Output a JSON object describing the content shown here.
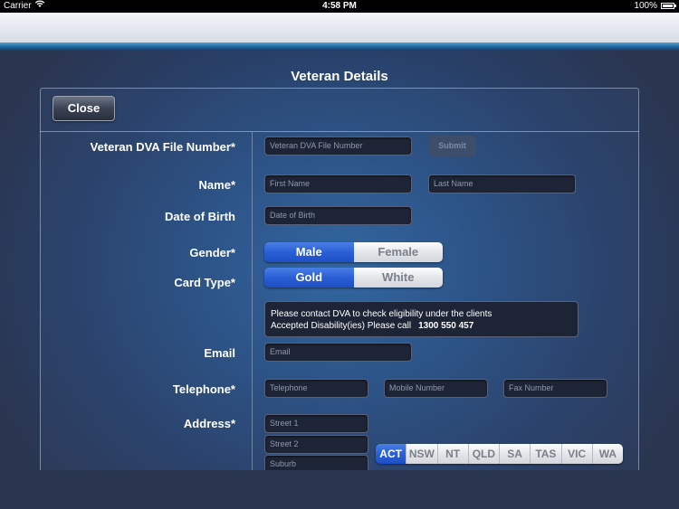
{
  "status_bar": {
    "carrier": "Carrier",
    "wifi_icon": "wifi-icon",
    "time": "4:58 PM",
    "battery_pct": "100%",
    "battery_icon": "battery-icon"
  },
  "page": {
    "title": "Veteran Details"
  },
  "toolbar": {
    "close_label": "Close",
    "submit_label": "Submit"
  },
  "labels": {
    "dva": "Veteran DVA File Number*",
    "name": "Name*",
    "dob": "Date of Birth",
    "gender": "Gender*",
    "card_type": "Card Type*",
    "email": "Email",
    "telephone": "Telephone*",
    "address": "Address*"
  },
  "placeholders": {
    "dva": "Veteran DVA File Number",
    "first_name": "First Name",
    "last_name": "Last Name",
    "dob": "Date of Birth",
    "email": "Email",
    "telephone": "Telephone",
    "mobile": "Mobile Number",
    "fax": "Fax Number",
    "street1": "Street 1",
    "street2": "Street 2",
    "suburb": "Suburb"
  },
  "gender": {
    "options": [
      "Male",
      "Female"
    ],
    "selected": "Male"
  },
  "card_type": {
    "options": [
      "Gold",
      "White"
    ],
    "selected": "Gold"
  },
  "info": {
    "line1": "Please contact DVA to check eligibility under the clients",
    "line2": "Accepted Disability(ies) Please call",
    "phone": "1300 550 457"
  },
  "states": {
    "options": [
      "ACT",
      "NSW",
      "NT",
      "QLD",
      "SA",
      "TAS",
      "VIC",
      "WA"
    ],
    "selected": "ACT"
  },
  "colors": {
    "accent": "#2a5fd6",
    "field_bg": "#1d2436"
  }
}
